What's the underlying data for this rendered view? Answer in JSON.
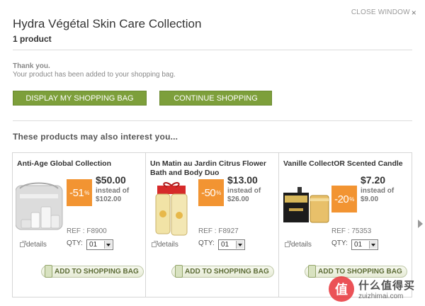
{
  "window": {
    "close_label": "CLOSE WINDOW",
    "close_glyph": "×"
  },
  "header": {
    "title": "Hydra Végétal Skin Care Collection",
    "count": "1 product"
  },
  "confirmation": {
    "thanks": "Thank you.",
    "message": "Your product has been added to your shopping bag."
  },
  "actions": {
    "display_bag": "DISPLAY MY SHOPPING BAG",
    "continue": "CONTINUE SHOPPING"
  },
  "recommend": {
    "heading": "These products may also interest you...",
    "products": [
      {
        "name": "Anti-Age Global Collection",
        "price": "$50.00",
        "instead_label": "instead of",
        "instead_price": "$102.00",
        "discount": "-51",
        "pct": "%",
        "ref": "REF : F8900",
        "details": "details",
        "qty_label": "QTY:",
        "qty": "01",
        "add_label": "ADD TO SHOPPING BAG",
        "image": "cosmetic-bag-image"
      },
      {
        "name": "Un Matin au Jardin Citrus Flower Bath and Body Duo",
        "price": "$13.00",
        "instead_label": "instead of",
        "instead_price": "$26.00",
        "discount": "-50",
        "pct": "%",
        "ref": "REF : F8927",
        "details": "details",
        "qty_label": "QTY:",
        "qty": "01",
        "add_label": "ADD TO SHOPPING BAG",
        "image": "bath-duo-image"
      },
      {
        "name": "Vanille CollectOR Scented Candle",
        "price": "$7.20",
        "instead_label": "instead of",
        "instead_price": "$9.00",
        "discount": "-20",
        "pct": "%",
        "ref": "REF : 75353",
        "details": "details",
        "qty_label": "QTY:",
        "qty": "01",
        "add_label": "ADD TO SHOPPING BAG",
        "image": "candle-image"
      }
    ]
  },
  "watermark": {
    "logo": "值",
    "cn": "什么值得买",
    "url": "zuizhimai.com"
  },
  "colors": {
    "green_button": "#7d9f3b",
    "discount_badge": "#f29432"
  }
}
